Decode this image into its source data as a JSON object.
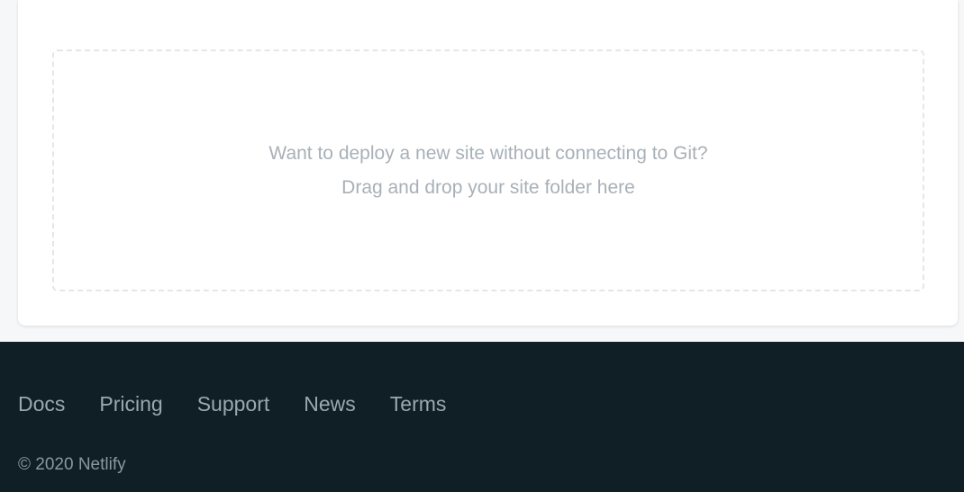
{
  "dropzone": {
    "line1": "Want to deploy a new site without connecting to Git?",
    "line2": "Drag and drop your site folder here"
  },
  "footer": {
    "links": [
      {
        "label": "Docs"
      },
      {
        "label": "Pricing"
      },
      {
        "label": "Support"
      },
      {
        "label": "News"
      },
      {
        "label": "Terms"
      }
    ],
    "copyright": "© 2020 Netlify"
  },
  "colors": {
    "page_background": "#f6f7f8",
    "card_background": "#ffffff",
    "dropzone_border": "#e4e7ea",
    "dropzone_text": "#a8b0b8",
    "footer_background": "#0f1f25",
    "footer_link": "#9aa8b0"
  }
}
